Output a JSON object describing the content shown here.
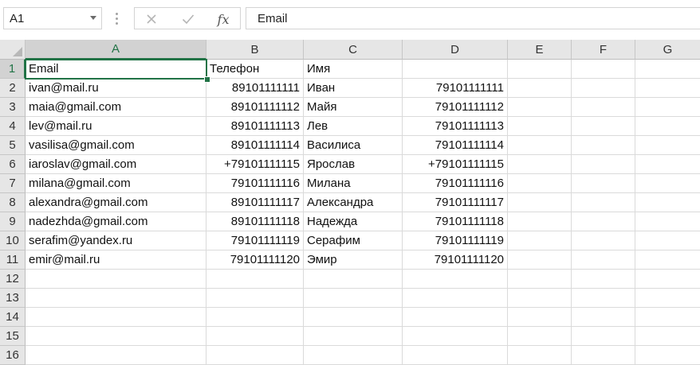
{
  "name_box": {
    "value": "A1"
  },
  "formula_bar": {
    "content": "Email",
    "fx_label": "fx"
  },
  "icons": {
    "cancel": "close-icon",
    "confirm": "checkmark-icon",
    "function": "fx-icon",
    "dropdown": "chevron-down-icon"
  },
  "colors": {
    "accent": "#217346",
    "header_bg": "#e6e6e6",
    "gridline": "#dadada"
  },
  "columns": [
    "A",
    "B",
    "C",
    "D",
    "E",
    "F",
    "G"
  ],
  "rows": [
    "1",
    "2",
    "3",
    "4",
    "5",
    "6",
    "7",
    "8",
    "9",
    "10",
    "11",
    "12",
    "13",
    "14",
    "15",
    "16"
  ],
  "selected_cell": {
    "column": "A",
    "row": "1"
  },
  "sheet": [
    [
      "Email",
      "Телефон",
      "Имя",
      "",
      "",
      "",
      ""
    ],
    [
      "ivan@mail.ru",
      "89101111111",
      "Иван",
      "79101111111",
      "",
      "",
      ""
    ],
    [
      "maia@gmail.com",
      "89101111112",
      "Майя",
      "79101111112",
      "",
      "",
      ""
    ],
    [
      "lev@mail.ru",
      "89101111113",
      "Лев",
      "79101111113",
      "",
      "",
      ""
    ],
    [
      "vasilisa@gmail.com",
      "89101111114",
      "Василиса",
      "79101111114",
      "",
      "",
      ""
    ],
    [
      "iaroslav@gmail.com",
      "+79101111115",
      "Ярослав",
      "+79101111115",
      "",
      "",
      ""
    ],
    [
      "milana@gmail.com",
      "79101111116",
      "Милана",
      "79101111116",
      "",
      "",
      ""
    ],
    [
      "alexandra@gmail.com",
      "89101111117",
      "Александра",
      "79101111117",
      "",
      "",
      ""
    ],
    [
      "nadezhda@gmail.com",
      "89101111118",
      "Надежда",
      "79101111118",
      "",
      "",
      ""
    ],
    [
      "serafim@yandex.ru",
      "79101111119",
      "Серафим",
      "79101111119",
      "",
      "",
      ""
    ],
    [
      "emir@mail.ru",
      "79101111120",
      "Эмир",
      "79101111120",
      "",
      "",
      ""
    ],
    [
      "",
      "",
      "",
      "",
      "",
      "",
      ""
    ],
    [
      "",
      "",
      "",
      "",
      "",
      "",
      ""
    ],
    [
      "",
      "",
      "",
      "",
      "",
      "",
      ""
    ],
    [
      "",
      "",
      "",
      "",
      "",
      "",
      ""
    ],
    [
      "",
      "",
      "",
      "",
      "",
      "",
      ""
    ]
  ]
}
